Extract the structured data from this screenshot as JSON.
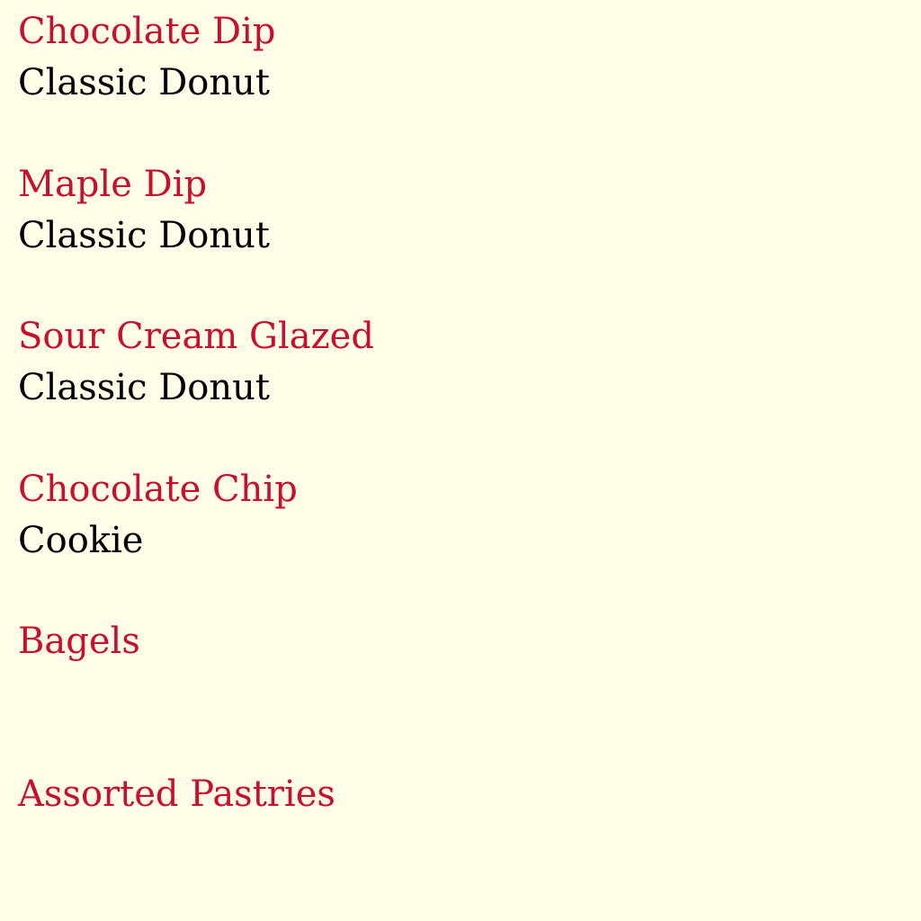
{
  "colors": {
    "background": "#fffde8",
    "item_name": "#c8102e",
    "item_type": "#000000"
  },
  "menu": {
    "items": [
      {
        "name": "Chocolate Dip",
        "type": "Classic Donut"
      },
      {
        "name": "Maple Dip",
        "type": "Classic Donut"
      },
      {
        "name": "Sour Cream Glazed",
        "type": "Classic Donut"
      },
      {
        "name": "Chocolate Chip",
        "type": "Cookie"
      },
      {
        "name": "Bagels",
        "type": ""
      },
      {
        "name": "Assorted Pastries",
        "type": ""
      }
    ]
  }
}
